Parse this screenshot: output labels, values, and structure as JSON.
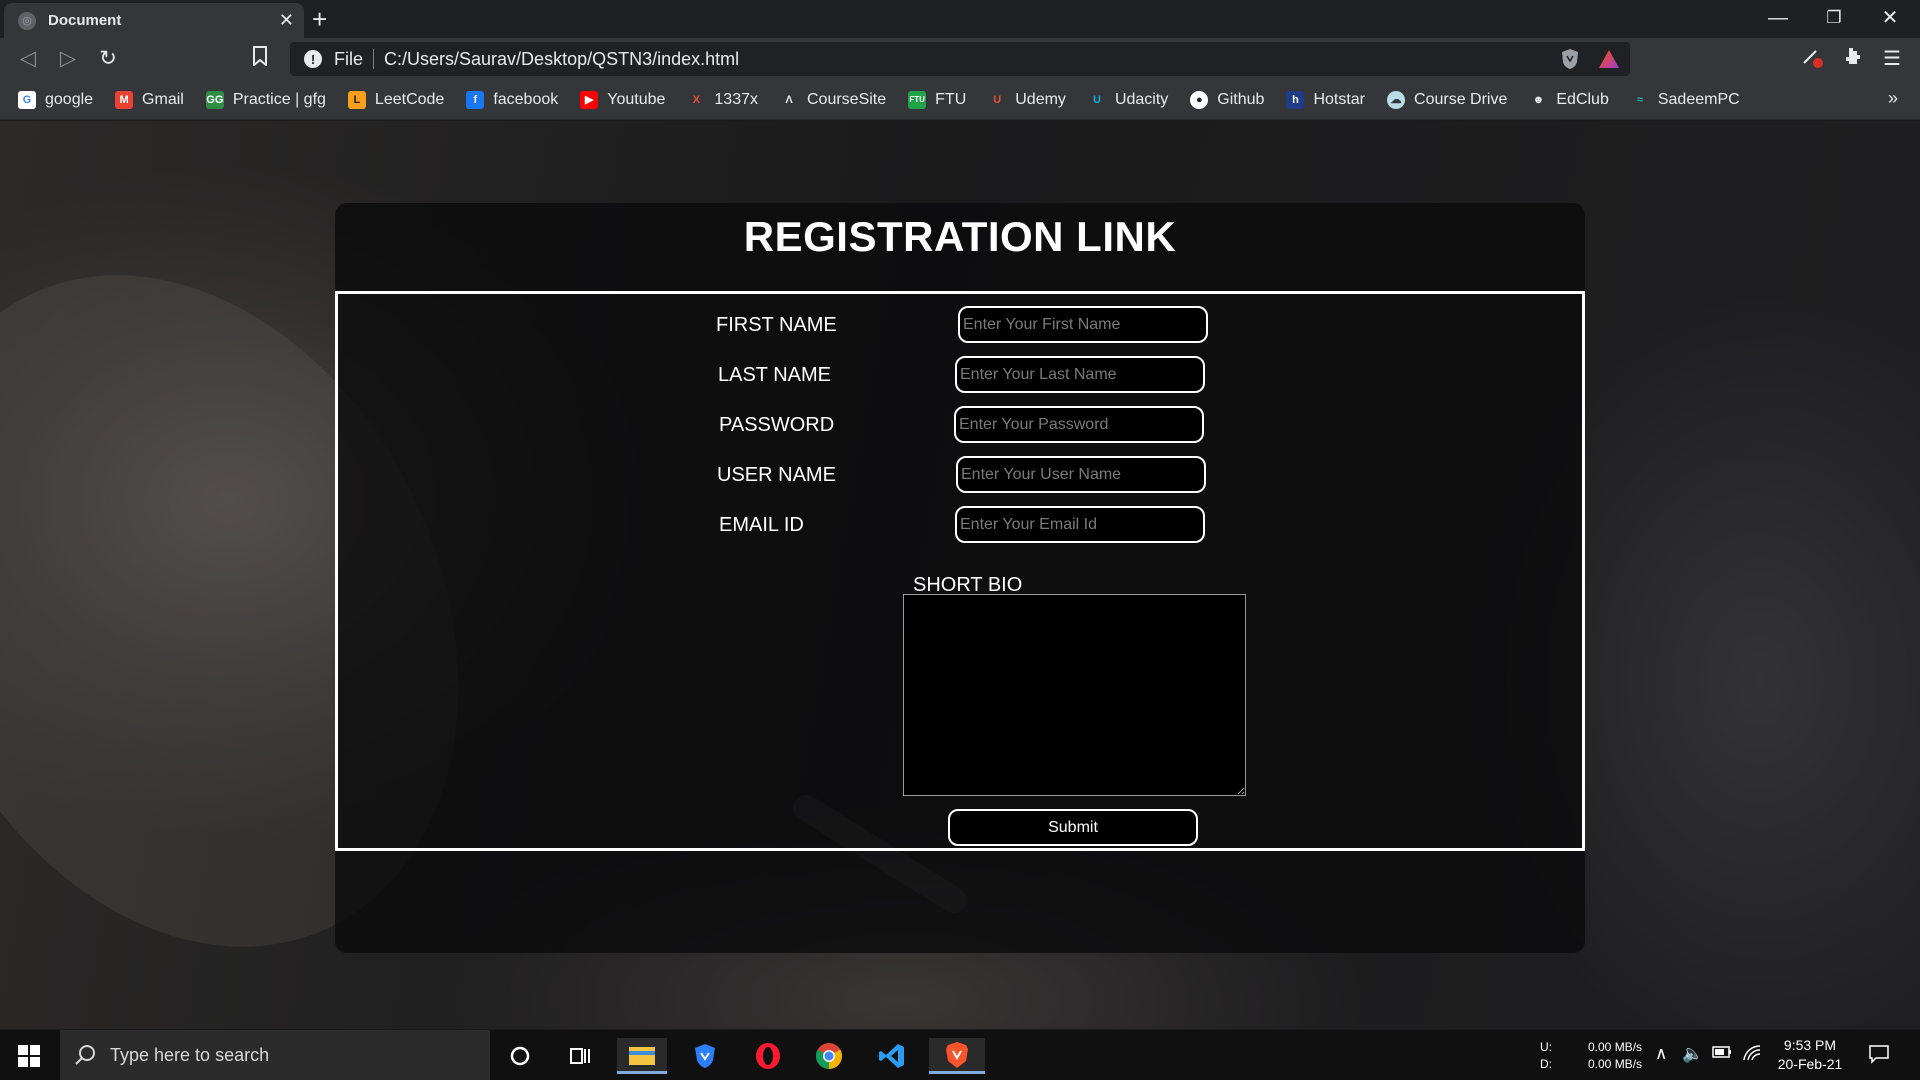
{
  "browser": {
    "tab_title": "Document",
    "tab_close": "✕",
    "new_tab": "+",
    "scheme": "File",
    "url": "C:/Users/Saurav/Desktop/QSTN3/index.html",
    "window_controls": [
      "—",
      "❐",
      "✕"
    ],
    "bookmarks": [
      {
        "label": "google",
        "icon": "google-icon",
        "color": "#ffffff",
        "glyph": "G",
        "text_color": "#4285f4"
      },
      {
        "label": "Gmail",
        "icon": "gmail-icon",
        "color": "#ea4335",
        "glyph": "M",
        "text_color": "#ffffff"
      },
      {
        "label": "Practice | gfg",
        "icon": "gfg-icon",
        "color": "#2f8d46",
        "glyph": "GG",
        "text_color": "#ffffff"
      },
      {
        "label": "LeetCode",
        "icon": "leetcode-icon",
        "color": "#f89f1b",
        "glyph": "L",
        "text_color": "#1e1e1e"
      },
      {
        "label": "facebook",
        "icon": "facebook-icon",
        "color": "#1877f2",
        "glyph": "f",
        "text_color": "#ffffff"
      },
      {
        "label": "Youtube",
        "icon": "youtube-icon",
        "color": "#ff0000",
        "glyph": "▶",
        "text_color": "#ffffff"
      },
      {
        "label": "1337x",
        "icon": "1337x-icon",
        "color": "#35363a",
        "glyph": "X",
        "text_color": "#e2513a"
      },
      {
        "label": "CourseSite",
        "icon": "coursesite-icon",
        "color": "#35363a",
        "glyph": "Λ",
        "text_color": "#e8eaed"
      },
      {
        "label": "FTU",
        "icon": "ftu-icon",
        "color": "#1fa34a",
        "glyph": "FTU",
        "text_color": "#ffffff"
      },
      {
        "label": "Udemy",
        "icon": "udemy-icon",
        "color": "#35363a",
        "glyph": "U",
        "text_color": "#e2513a"
      },
      {
        "label": "Udacity",
        "icon": "udacity-icon",
        "color": "#35363a",
        "glyph": "U",
        "text_color": "#02b3e4"
      },
      {
        "label": "Github",
        "icon": "github-icon",
        "color": "#ffffff",
        "glyph": "●",
        "text_color": "#1f2023"
      },
      {
        "label": "Hotstar",
        "icon": "hotstar-icon",
        "color": "#1f3c88",
        "glyph": "h",
        "text_color": "#ffffff"
      },
      {
        "label": "Course Drive",
        "icon": "course-drive-icon",
        "color": "#b8dce8",
        "glyph": "☁",
        "text_color": "#35363a"
      },
      {
        "label": "EdClub",
        "icon": "edclub-icon",
        "color": "#35363a",
        "glyph": "☻",
        "text_color": "#e8eaed"
      },
      {
        "label": "SadeemPC",
        "icon": "sadeempc-icon",
        "color": "#35363a",
        "glyph": "≈",
        "text_color": "#1fb5a3"
      }
    ],
    "more_bookmarks": "»"
  },
  "form": {
    "title": "REGISTRATION LINK",
    "fields": [
      {
        "label": "FIRST NAME",
        "placeholder": "Enter Your First Name",
        "value": ""
      },
      {
        "label": "LAST NAME",
        "placeholder": "Enter Your Last Name",
        "value": ""
      },
      {
        "label": "PASSWORD",
        "placeholder": "Enter Your Password",
        "value": ""
      },
      {
        "label": "USER NAME",
        "placeholder": "Enter Your User Name",
        "value": ""
      },
      {
        "label": "EMAIL ID",
        "placeholder": "Enter Your Email Id",
        "value": ""
      }
    ],
    "bio_label": "SHORT BIO",
    "bio_value": "",
    "submit_label": "Submit"
  },
  "taskbar": {
    "search_placeholder": "Type here to search",
    "net_labels": [
      "U:",
      "D:"
    ],
    "net_values": [
      "0.00 MB/s",
      "0.00 MB/s"
    ],
    "time": "9:53 PM",
    "date": "20-Feb-21"
  },
  "colors": {
    "chrome_bg": "#35363a",
    "titlebar_bg": "#1f2023",
    "card_bg": "#0a0a0c",
    "accent_white": "#ffffff"
  }
}
